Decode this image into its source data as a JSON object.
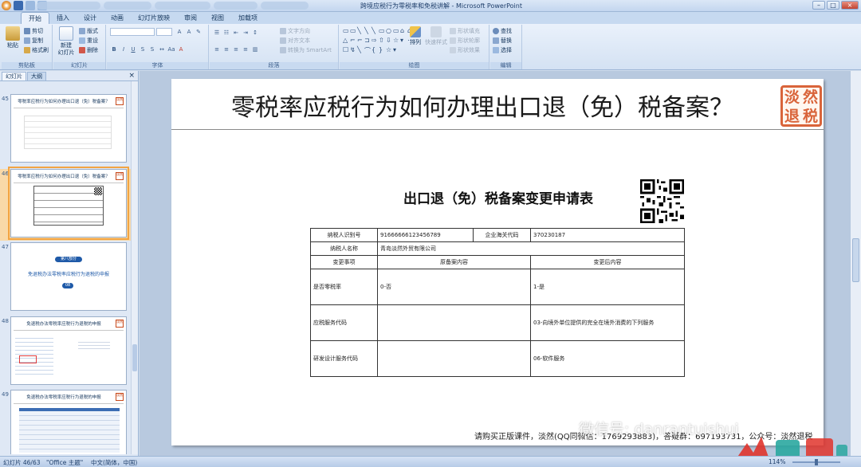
{
  "window": {
    "title": "跨境应税行为零税率和免税讲解 - Microsoft PowerPoint",
    "controls": [
      "–",
      "□",
      "×"
    ]
  },
  "ribbon": {
    "tabs": [
      "开始",
      "插入",
      "设计",
      "动画",
      "幻灯片放映",
      "审阅",
      "视图",
      "加载项"
    ],
    "active_tab": "开始",
    "groups": {
      "clipboard": {
        "label": "剪贴板",
        "paste": "粘贴",
        "cut": "剪切",
        "copy": "复制",
        "format_painter": "格式刷"
      },
      "slides": {
        "label": "幻灯片",
        "new_slide": "新建\n幻灯片",
        "layout": "版式",
        "reset": "重设",
        "delete": "删除"
      },
      "font": {
        "label": "字体"
      },
      "paragraph": {
        "label": "段落",
        "text_direction": "文字方向",
        "align_text": "对齐文本",
        "smartart": "转换为 SmartArt"
      },
      "drawing": {
        "label": "绘图",
        "arrange": "排列",
        "quick_styles": "快速样式",
        "shape_fill": "形状填充",
        "shape_outline": "形状轮廓",
        "shape_effects": "形状效果"
      },
      "editing": {
        "label": "编辑",
        "find": "查找",
        "replace": "替换",
        "select": "选择"
      }
    }
  },
  "left_panel": {
    "tabs": [
      "幻灯片",
      "大纲"
    ],
    "active_tab": "幻灯片",
    "close": "×",
    "thumbnails": [
      {
        "num": "45",
        "title": "零税率应税行为如何办理出口退（免）税备案？",
        "selected": false
      },
      {
        "num": "46",
        "title": "零税率应税行为如何办理出口退（免）税备案？",
        "selected": true
      },
      {
        "num": "47",
        "title": "",
        "pill": "第八部分",
        "subtitle": "免退税办法零税率应税行为退税的申报",
        "page_badge": "08",
        "selected": false
      },
      {
        "num": "48",
        "title": "免退税办法零税率应税行为退税的申报",
        "selected": false
      },
      {
        "num": "49",
        "title": "免退税办法零税率应税行为退税的申报",
        "selected": false
      }
    ]
  },
  "slide": {
    "title": "零税率应税行为如何办理出口退（免）税备案？",
    "seal_chars": [
      "淡",
      "然",
      "退",
      "税"
    ],
    "form": {
      "heading": "出口退（免）税备案变更申请表",
      "rows": [
        [
          "纳税人识别号",
          "91666666123456789",
          "企业海关代码",
          "370230187"
        ],
        [
          "纳税人名称",
          "青岛淡然外贸有限公司"
        ],
        [
          "变更事项",
          "原备案内容",
          "变更后内容"
        ],
        [
          "是否零税率",
          "0-否",
          "1-是"
        ],
        [
          "应税服务代码",
          "",
          "03-向境外单位提供的完全在境外消费的下列服务"
        ],
        [
          "研发设计服务代码",
          "",
          "06-软件服务"
        ]
      ]
    },
    "footer": "请购买正版课件，淡然(QQ同微信：1769293883)，答疑群：697193731，公众号：淡然退税"
  },
  "overlay": {
    "watermark": "微信号: danrantuishui"
  },
  "status": {
    "slide_pos": "幻灯片 46/63",
    "theme": "\"Office 主题\"",
    "language": "中文(简体，中国)",
    "zoom": "114%"
  },
  "colors": {
    "seal": "#d9643a",
    "selection": "#f2a443",
    "ribbon": "#d4e2f3"
  }
}
